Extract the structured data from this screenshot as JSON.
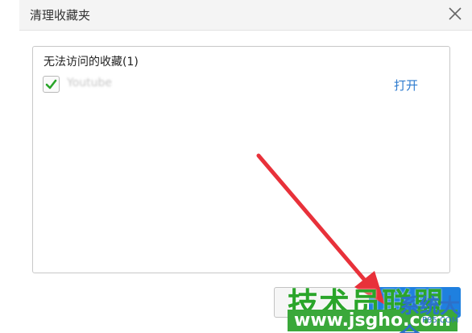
{
  "dialog": {
    "title": "清理收藏夹"
  },
  "section": {
    "header": "无法访问的收藏(1)"
  },
  "items": [
    {
      "name": "Youtube",
      "checked": true,
      "action_label": "打开"
    }
  ],
  "watermark": {
    "main_text": "技术员联盟",
    "site_text": "www.jsgho.com",
    "right_text": "系统大全",
    "small_text": "P85.COM"
  },
  "colors": {
    "link": "#2e7bcf",
    "check": "#2aa52a",
    "arrow": "#e8313a",
    "watermark_green": "#2aa52a",
    "watermark_blue": "#2c70c8"
  },
  "icons": {
    "close": "close-icon",
    "check": "checkmark-icon",
    "arrow": "arrow-annotation"
  }
}
